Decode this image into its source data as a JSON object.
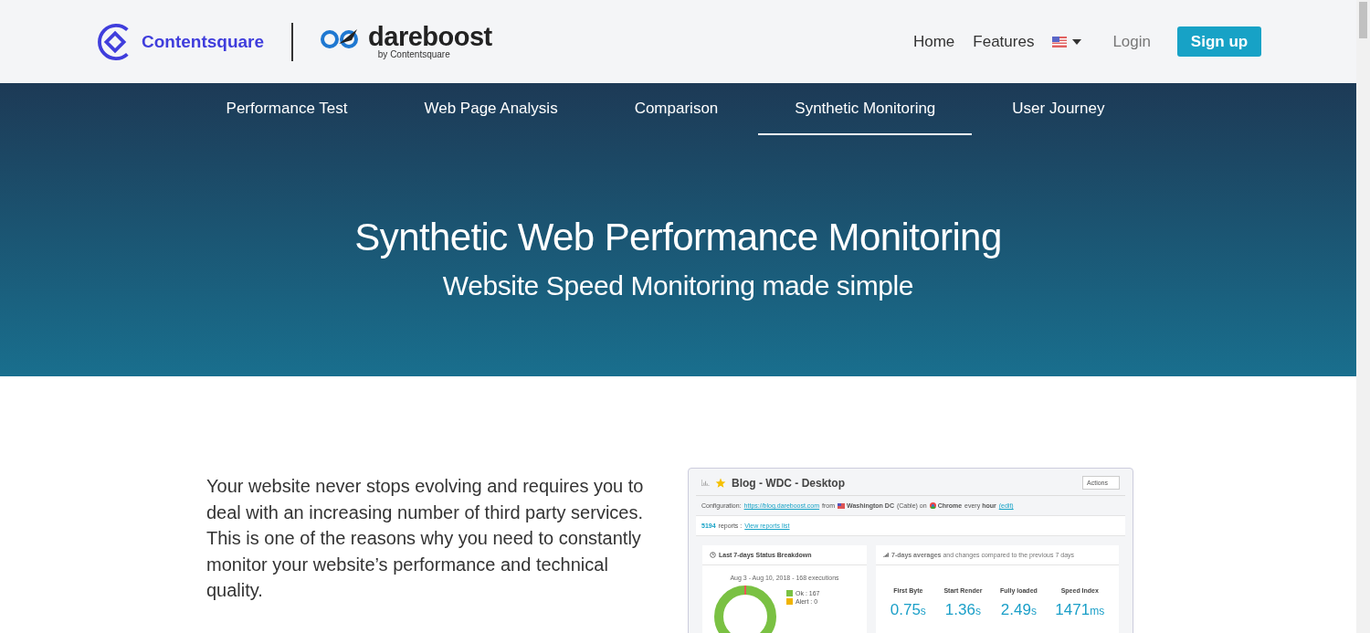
{
  "header": {
    "brand": "Contentsquare",
    "product": "dareboost",
    "product_tagline": "by Contentsquare",
    "nav": [
      {
        "label": "Home",
        "kind": "link"
      },
      {
        "label": "Features",
        "kind": "link"
      },
      {
        "kind": "language"
      },
      {
        "label": "Login",
        "kind": "muted"
      },
      {
        "label": "Sign up",
        "kind": "button"
      }
    ]
  },
  "tabs": [
    {
      "label": "Performance Test",
      "selected": false
    },
    {
      "label": "Web Page Analysis",
      "selected": false
    },
    {
      "label": "Comparison",
      "selected": false
    },
    {
      "label": "Synthetic Monitoring",
      "selected": true
    },
    {
      "label": "User Journey",
      "selected": false
    }
  ],
  "hero": {
    "title": "Synthetic Web Performance Monitoring",
    "subtitle": "Website Speed Monitoring made simple"
  },
  "intro": "Your website never stops evolving and requires you to deal with an increasing number of third party services. This is one of the reasons why you need to constantly monitor your website’s performance and technical quality.",
  "dashboard": {
    "title": "Blog - WDC - Desktop",
    "actions": "Actions",
    "config": [
      {
        "kind": "text",
        "text": "Configuration:"
      },
      {
        "kind": "link",
        "text": "https://blog.dareboost.com"
      },
      {
        "kind": "text",
        "text": "from"
      },
      {
        "kind": "flag",
        "text": "Washington DC"
      },
      {
        "kind": "text",
        "text": "(Cable) on"
      },
      {
        "kind": "chrome",
        "text": "Chrome"
      },
      {
        "kind": "text",
        "text": "every **hour**"
      },
      {
        "kind": "link",
        "text": "(edit)"
      }
    ],
    "reports_count": "5194",
    "reports_label": "reports :",
    "reports_link": "View reports list",
    "status": {
      "title": "Last 7-days Status Breakdown",
      "range": "Aug 3 - Aug 10, 2018 - 168 executions",
      "legend": [
        {
          "label": "Ok : 167",
          "color": "#7ac143"
        },
        {
          "label": "Alert : 0",
          "color": "#f0b400"
        }
      ]
    },
    "averages": {
      "title": "**7-days averages** and changes compared to the previous 7 days",
      "metrics": [
        {
          "label": "First Byte",
          "value": "0.75",
          "unit": "s"
        },
        {
          "label": "Start Render",
          "value": "1.36",
          "unit": "s"
        },
        {
          "label": "Fully loaded",
          "value": "2.49",
          "unit": "s"
        },
        {
          "label": "Speed Index",
          "value": "1471",
          "unit": "ms"
        }
      ]
    }
  }
}
